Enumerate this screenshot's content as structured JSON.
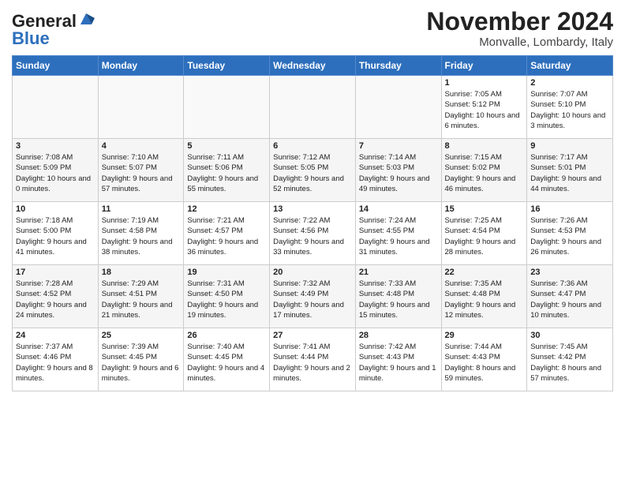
{
  "header": {
    "logo_line1": "General",
    "logo_line2": "Blue",
    "month": "November 2024",
    "location": "Monvalle, Lombardy, Italy"
  },
  "weekdays": [
    "Sunday",
    "Monday",
    "Tuesday",
    "Wednesday",
    "Thursday",
    "Friday",
    "Saturday"
  ],
  "weeks": [
    [
      {
        "day": "",
        "info": ""
      },
      {
        "day": "",
        "info": ""
      },
      {
        "day": "",
        "info": ""
      },
      {
        "day": "",
        "info": ""
      },
      {
        "day": "",
        "info": ""
      },
      {
        "day": "1",
        "info": "Sunrise: 7:05 AM\nSunset: 5:12 PM\nDaylight: 10 hours and 6 minutes."
      },
      {
        "day": "2",
        "info": "Sunrise: 7:07 AM\nSunset: 5:10 PM\nDaylight: 10 hours and 3 minutes."
      }
    ],
    [
      {
        "day": "3",
        "info": "Sunrise: 7:08 AM\nSunset: 5:09 PM\nDaylight: 10 hours and 0 minutes."
      },
      {
        "day": "4",
        "info": "Sunrise: 7:10 AM\nSunset: 5:07 PM\nDaylight: 9 hours and 57 minutes."
      },
      {
        "day": "5",
        "info": "Sunrise: 7:11 AM\nSunset: 5:06 PM\nDaylight: 9 hours and 55 minutes."
      },
      {
        "day": "6",
        "info": "Sunrise: 7:12 AM\nSunset: 5:05 PM\nDaylight: 9 hours and 52 minutes."
      },
      {
        "day": "7",
        "info": "Sunrise: 7:14 AM\nSunset: 5:03 PM\nDaylight: 9 hours and 49 minutes."
      },
      {
        "day": "8",
        "info": "Sunrise: 7:15 AM\nSunset: 5:02 PM\nDaylight: 9 hours and 46 minutes."
      },
      {
        "day": "9",
        "info": "Sunrise: 7:17 AM\nSunset: 5:01 PM\nDaylight: 9 hours and 44 minutes."
      }
    ],
    [
      {
        "day": "10",
        "info": "Sunrise: 7:18 AM\nSunset: 5:00 PM\nDaylight: 9 hours and 41 minutes."
      },
      {
        "day": "11",
        "info": "Sunrise: 7:19 AM\nSunset: 4:58 PM\nDaylight: 9 hours and 38 minutes."
      },
      {
        "day": "12",
        "info": "Sunrise: 7:21 AM\nSunset: 4:57 PM\nDaylight: 9 hours and 36 minutes."
      },
      {
        "day": "13",
        "info": "Sunrise: 7:22 AM\nSunset: 4:56 PM\nDaylight: 9 hours and 33 minutes."
      },
      {
        "day": "14",
        "info": "Sunrise: 7:24 AM\nSunset: 4:55 PM\nDaylight: 9 hours and 31 minutes."
      },
      {
        "day": "15",
        "info": "Sunrise: 7:25 AM\nSunset: 4:54 PM\nDaylight: 9 hours and 28 minutes."
      },
      {
        "day": "16",
        "info": "Sunrise: 7:26 AM\nSunset: 4:53 PM\nDaylight: 9 hours and 26 minutes."
      }
    ],
    [
      {
        "day": "17",
        "info": "Sunrise: 7:28 AM\nSunset: 4:52 PM\nDaylight: 9 hours and 24 minutes."
      },
      {
        "day": "18",
        "info": "Sunrise: 7:29 AM\nSunset: 4:51 PM\nDaylight: 9 hours and 21 minutes."
      },
      {
        "day": "19",
        "info": "Sunrise: 7:31 AM\nSunset: 4:50 PM\nDaylight: 9 hours and 19 minutes."
      },
      {
        "day": "20",
        "info": "Sunrise: 7:32 AM\nSunset: 4:49 PM\nDaylight: 9 hours and 17 minutes."
      },
      {
        "day": "21",
        "info": "Sunrise: 7:33 AM\nSunset: 4:48 PM\nDaylight: 9 hours and 15 minutes."
      },
      {
        "day": "22",
        "info": "Sunrise: 7:35 AM\nSunset: 4:48 PM\nDaylight: 9 hours and 12 minutes."
      },
      {
        "day": "23",
        "info": "Sunrise: 7:36 AM\nSunset: 4:47 PM\nDaylight: 9 hours and 10 minutes."
      }
    ],
    [
      {
        "day": "24",
        "info": "Sunrise: 7:37 AM\nSunset: 4:46 PM\nDaylight: 9 hours and 8 minutes."
      },
      {
        "day": "25",
        "info": "Sunrise: 7:39 AM\nSunset: 4:45 PM\nDaylight: 9 hours and 6 minutes."
      },
      {
        "day": "26",
        "info": "Sunrise: 7:40 AM\nSunset: 4:45 PM\nDaylight: 9 hours and 4 minutes."
      },
      {
        "day": "27",
        "info": "Sunrise: 7:41 AM\nSunset: 4:44 PM\nDaylight: 9 hours and 2 minutes."
      },
      {
        "day": "28",
        "info": "Sunrise: 7:42 AM\nSunset: 4:43 PM\nDaylight: 9 hours and 1 minute."
      },
      {
        "day": "29",
        "info": "Sunrise: 7:44 AM\nSunset: 4:43 PM\nDaylight: 8 hours and 59 minutes."
      },
      {
        "day": "30",
        "info": "Sunrise: 7:45 AM\nSunset: 4:42 PM\nDaylight: 8 hours and 57 minutes."
      }
    ]
  ]
}
